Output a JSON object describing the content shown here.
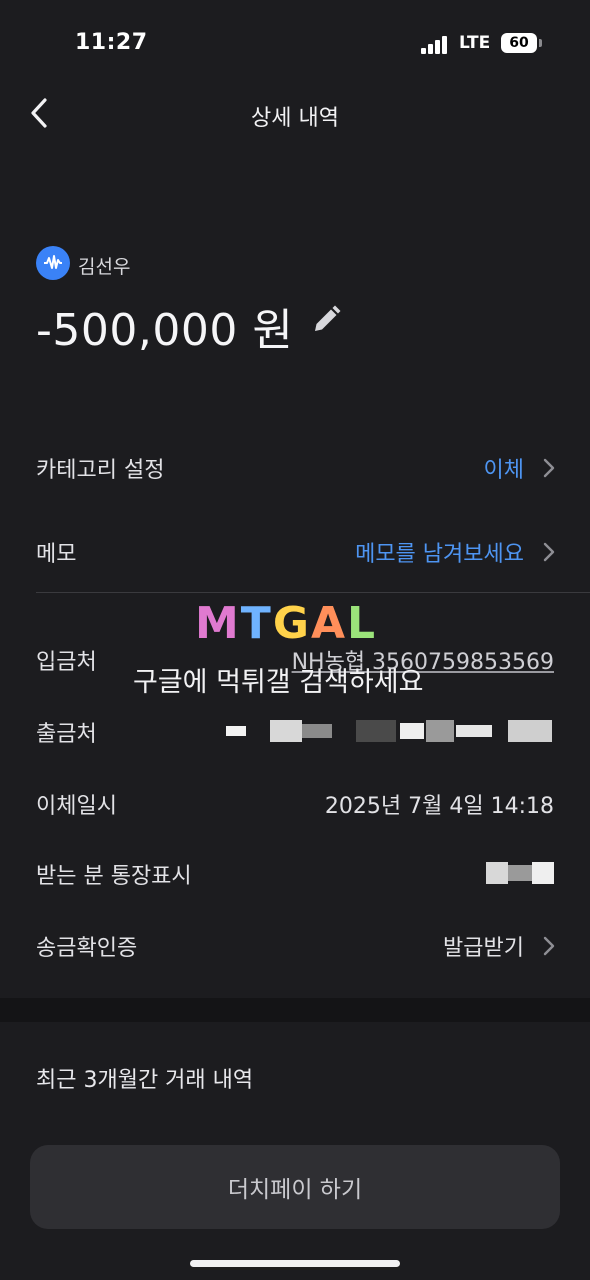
{
  "status_bar": {
    "time": "11:27",
    "network": "LTE",
    "battery": "60"
  },
  "header": {
    "title": "상세 내역",
    "back_icon": "chevron-left-icon"
  },
  "transaction": {
    "account_name": "김선우",
    "amount": "-500,000 원",
    "edit_icon": "pencil-icon"
  },
  "details": {
    "category": {
      "label": "카테고리 설정",
      "value": "이체"
    },
    "memo": {
      "label": "메모",
      "value": "메모를 남겨보세요"
    },
    "deposit_to": {
      "label": "입금처",
      "value": "NH농협 3560759853569"
    },
    "withdraw_from": {
      "label": "출금처"
    },
    "transfer_datetime": {
      "label": "이체일시",
      "value": "2025년 7월 4일 14:18"
    },
    "recipient_display": {
      "label": "받는 분 통장표시"
    },
    "certificate": {
      "label": "송금확인증",
      "value": "발급받기"
    }
  },
  "recent_section": {
    "title": "최근 3개월간 거래 내역"
  },
  "action": {
    "dutch_pay_label": "더치페이 하기"
  },
  "watermark": {
    "logo": "MTGAL",
    "text": "구글에 먹튀갤 검색하세요"
  },
  "colors": {
    "background": "#1c1c1f",
    "link": "#4e95f2",
    "account_icon": "#3a82f7"
  }
}
